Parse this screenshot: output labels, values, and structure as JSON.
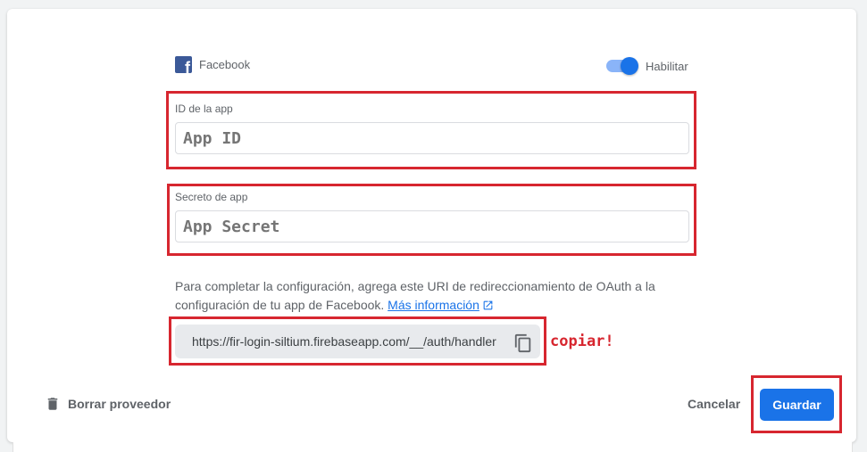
{
  "provider": {
    "name": "Facebook",
    "icon": "facebook-icon"
  },
  "enable_toggle": {
    "label": "Habilitar",
    "on": true,
    "color": "#1a73e8"
  },
  "fields": {
    "app_id": {
      "label": "ID de la app",
      "placeholder": "App ID"
    },
    "app_secret": {
      "label": "Secreto de app",
      "placeholder": "App Secret"
    }
  },
  "help": {
    "text": "Para completar la configuración, agrega este URI de redireccionamiento de OAuth a la configuración de tu app de Facebook.",
    "link_text": "Más información"
  },
  "redirect_uri": "https://fir-login-siltium.firebaseapp.com/__/auth/handler",
  "annotation": {
    "text": "copiar!",
    "color": "#d7262f"
  },
  "footer": {
    "delete_label": "Borrar proveedor",
    "cancel_label": "Cancelar",
    "save_label": "Guardar"
  },
  "colors": {
    "accent": "#1a73e8",
    "highlight": "#d7262f"
  }
}
